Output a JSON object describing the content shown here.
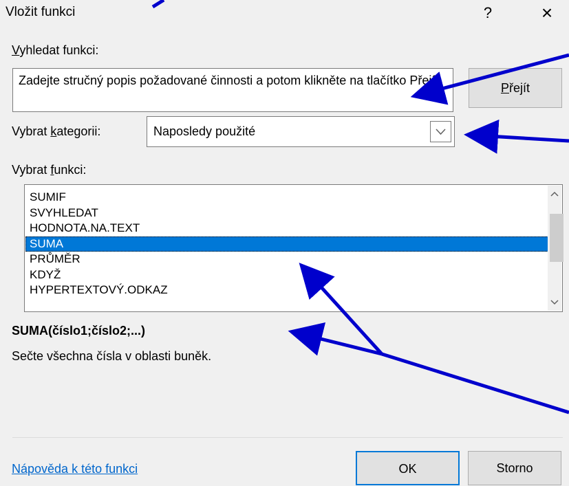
{
  "dialog": {
    "title": "Vložit funkci",
    "help_label": "?",
    "close_label": "×"
  },
  "search": {
    "label_accel": "V",
    "label_rest": "yhledat funkci:",
    "value": "Zadejte stručný popis požadované činnosti a potom klikněte na tlačítko Přejít.",
    "go_accel": "P",
    "go_rest": "řejít"
  },
  "category": {
    "label_pre": "Vybrat ",
    "label_accel": "k",
    "label_post": "ategorii:",
    "selected": "Naposledy použité"
  },
  "functions": {
    "label_pre": "Vybrat ",
    "label_accel": "f",
    "label_post": "unkci:",
    "items": [
      "SUMIF",
      "SVYHLEDAT",
      "HODNOTA.NA.TEXT",
      "SUMA",
      "PRŮMĚR",
      "KDYŽ",
      "HYPERTEXTOVÝ.ODKAZ"
    ],
    "selected_index": 3
  },
  "details": {
    "syntax": "SUMA(číslo1;číslo2;...)",
    "description": "Sečte všechna čísla v oblasti buněk."
  },
  "footer": {
    "help_link": "Nápověda k této funkci",
    "ok_label": "OK",
    "cancel_label": "Storno"
  },
  "colors": {
    "selection": "#0078d7",
    "annotation_arrow": "#0000cc",
    "link": "#0066cc"
  }
}
